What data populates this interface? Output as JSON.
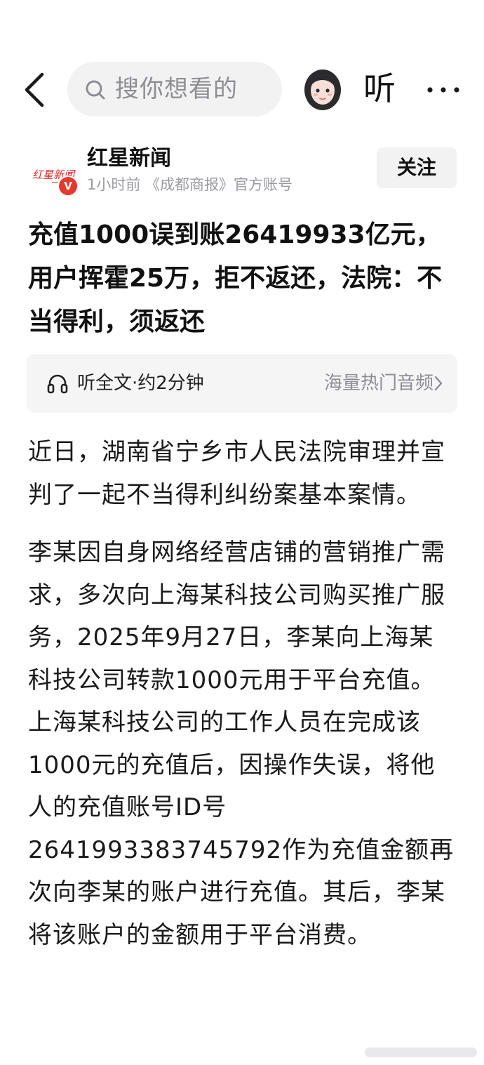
{
  "header": {
    "search_placeholder": "搜你想看的",
    "listen_label": "听"
  },
  "author": {
    "logo_text": "红星新闻",
    "verified_mark": "V",
    "name": "红星新闻",
    "meta": "1小时前  《成都商报》官方账号",
    "follow_label": "关注"
  },
  "article": {
    "title": "充值1000误到账26419933亿元，用户挥霍25万，拒不返还，法院：不当得利，须返还",
    "audio": {
      "label": "听全文·约2分钟",
      "link": "海量热门音频"
    },
    "paragraphs": [
      "近日，湖南省宁乡市人民法院审理并宣判了一起不当得利纠纷案基本案情。",
      "李某因自身网络经营店铺的营销推广需求，多次向上海某科技公司购买推广服务，2025年9月27日，李某向上海某科技公司转款1000元用于平台充值。上海某科技公司的工作人员在完成该1000元的充值后，因操作失误，将他人的充值账号ID号2641993383745792作为充值金额再次向李某的账户进行充值。其后，李某将该账户的金额用于平台消费。"
    ]
  },
  "colors": {
    "verified_red": "#e33a30",
    "logo_red": "#d9261c",
    "muted_gray": "#8d8d93",
    "chip_bg": "#f2f2f3"
  }
}
